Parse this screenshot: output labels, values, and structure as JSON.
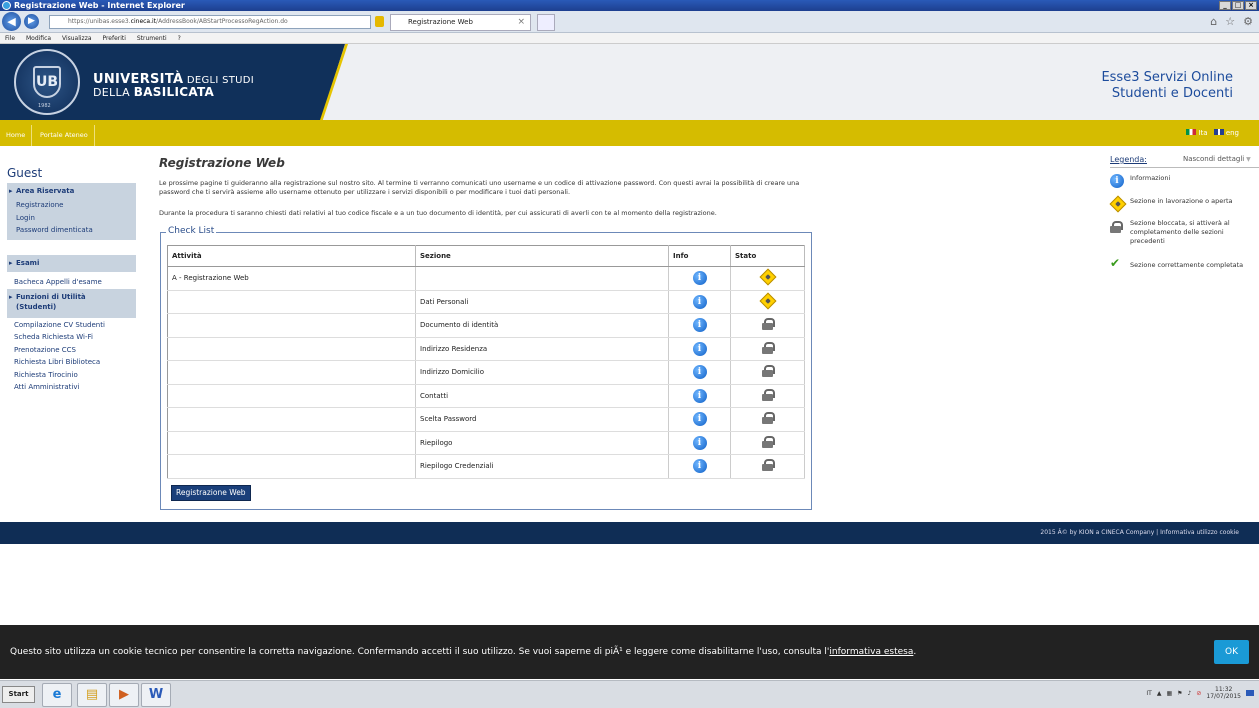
{
  "browser": {
    "window_title": "Registrazione Web - Internet Explorer",
    "url_prefix": "https://unibas.esse3.",
    "url_domain": "cineca.it",
    "url_path": "/AddressBook/ABStartProcessoRegAction.do",
    "tab_title": "Registrazione Web",
    "menu": [
      "File",
      "Modifica",
      "Visualizza",
      "Preferiti",
      "Strumenti",
      "?"
    ]
  },
  "header": {
    "univ_line1_bold": "UNIVERSITÀ",
    "univ_line1_rest": " DEGLI STUDI",
    "univ_line2_pre": "DELLA ",
    "univ_line2_bold": "BASILICATA",
    "seal_letters": "UB",
    "seal_year": "1982",
    "esse3_line1": "Esse3 Servizi Online",
    "esse3_line2": "Studenti e Docenti"
  },
  "topnav": {
    "home": "Home",
    "portale": "Portale Ateneo",
    "lang_ita": "Ita",
    "lang_eng": "eng"
  },
  "sidebar": {
    "guest": "Guest",
    "area_riservata": "Area Riservata",
    "area_items": [
      "Registrazione",
      "Login",
      "Password dimenticata"
    ],
    "esami": "Esami",
    "esami_items": [
      "Bacheca Appelli d'esame"
    ],
    "funzioni_line1": "Funzioni di Utilità",
    "funzioni_line2": "(Studenti)",
    "funzioni_items": [
      "Compilazione CV Studenti",
      "Scheda Richiesta Wi-Fi",
      "Prenotazione CCS",
      "Richiesta Libri Biblioteca",
      "Richiesta Tirocinio",
      "Atti Amministrativi"
    ]
  },
  "main": {
    "title": "Registrazione Web",
    "intro1": "Le prossime pagine ti guideranno alla registrazione sul nostro sito. Al termine ti verranno comunicati uno username e un codice di attivazione password. Con questi avrai la possibilità di creare una password che ti servirà assieme allo username ottenuto per utilizzare i servizi disponibili o per modificare i tuoi dati personali.",
    "intro2": "Durante la procedura ti saranno chiesti dati relativi al tuo codice fiscale e a un tuo documento di identità, per cui assicurati di averli con te al momento della registrazione.",
    "checklist_legend": "Check List",
    "columns": [
      "Attività",
      "Sezione",
      "Info",
      "Stato"
    ],
    "rows": [
      {
        "attivita": "A - Registrazione Web",
        "sezione": "",
        "stato": "open"
      },
      {
        "attivita": "",
        "sezione": "Dati Personali",
        "stato": "open"
      },
      {
        "attivita": "",
        "sezione": "Documento di identità",
        "stato": "locked"
      },
      {
        "attivita": "",
        "sezione": "Indirizzo Residenza",
        "stato": "locked"
      },
      {
        "attivita": "",
        "sezione": "Indirizzo Domicilio",
        "stato": "locked"
      },
      {
        "attivita": "",
        "sezione": "Contatti",
        "stato": "locked"
      },
      {
        "attivita": "",
        "sezione": "Scelta Password",
        "stato": "locked"
      },
      {
        "attivita": "",
        "sezione": "Riepilogo",
        "stato": "locked"
      },
      {
        "attivita": "",
        "sezione": "Riepilogo Credenziali",
        "stato": "locked"
      }
    ],
    "button_label": "Registrazione Web"
  },
  "legend": {
    "title": "Legenda:",
    "hide": "Nascondi dettagli",
    "items": [
      "Informazioni",
      "Sezione in lavorazione o aperta",
      "Sezione bloccata, si attiverà al completamento delle sezioni precedenti",
      "Sezione correttamente completata"
    ]
  },
  "footer": {
    "text": "2015 Â© by KION a CINECA Company | Informativa utilizzo cookie"
  },
  "cookie": {
    "text": "Questo sito utilizza un cookie tecnico per consentire la corretta navigazione. Confermando accetti il suo utilizzo. Se vuoi saperne di piÃ¹ e leggere come disabilitarne l'uso, consulta l'",
    "link": "informativa estesa",
    "end": ".",
    "ok": "OK"
  },
  "taskbar": {
    "start": "Start",
    "lang": "IT",
    "time": "11:32",
    "date": "17/07/2015"
  },
  "colors": {
    "navy": "#10305a",
    "yellow": "#d5bc00",
    "link": "#1d3c78",
    "ok_button": "#1a9ad6"
  }
}
